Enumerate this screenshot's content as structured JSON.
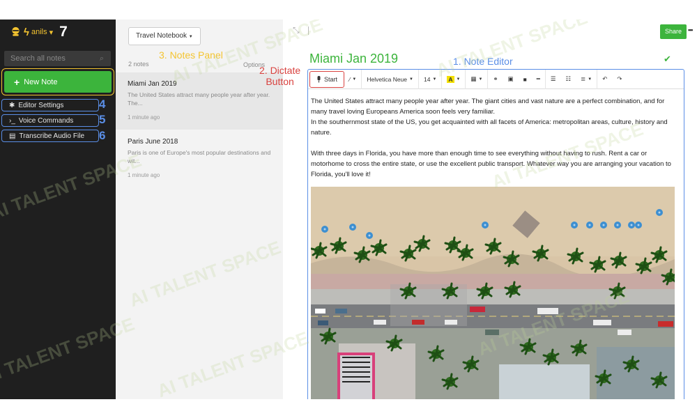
{
  "sidebar": {
    "username": "anils",
    "user_badge_number": "7",
    "search_placeholder": "Search all notes",
    "new_note_label": "New Note",
    "buttons": [
      {
        "label": "Editor Settings",
        "icon": "gear-icon",
        "number": "4"
      },
      {
        "label": "Voice Commands",
        "icon": "terminal-icon",
        "number": "5"
      },
      {
        "label": "Transcribe Audio File",
        "icon": "file-icon",
        "number": "6"
      }
    ]
  },
  "notes_panel": {
    "notebook": "Travel Notebook",
    "count": "2 notes",
    "heading": "3. Notes Panel",
    "options": "Options",
    "notes": [
      {
        "title": "Miami Jan 2019",
        "snippet": "The United States attract many people year after year. The...",
        "time": "1 minute ago"
      },
      {
        "title": "Paris June 2018",
        "snippet": "Paris is one of Europe's most popular destinations and wit...",
        "time": "1 minute ago"
      }
    ]
  },
  "annotations": {
    "dictate_line1": "2. Dictate",
    "dictate_line2": "Button",
    "editor": "1. Note Editor"
  },
  "editor": {
    "share_label": "Share",
    "note_title": "Miami Jan 2019",
    "toolbar": {
      "start_label": "Start",
      "font": "Helvetica Neue",
      "size": "14"
    },
    "paragraphs": [
      "The United States attract many people year after year. The giant cities and vast nature are a perfect combination, and for many travel loving Europeans America soon feels very familiar.",
      "In the southernmost state of the US, you get acquainted with all facets of America: metropolitan areas, culture, history and nature.",
      "With three days in Florida, you have more than enough time to see everything without having to rush. Rent a car or motorhome to cross the entire state, or use the excellent public transport. Whatever way you are arranging your vacation to Florida, you'll love it!"
    ]
  },
  "watermark": "AI TALENT SPACE",
  "colors": {
    "sidebar_bg": "#1f1f1f",
    "accent_green": "#3cb43c",
    "highlight_yellow": "#f4c430",
    "annotation_blue": "#5a8ee6",
    "annotation_red": "#d9423f"
  }
}
